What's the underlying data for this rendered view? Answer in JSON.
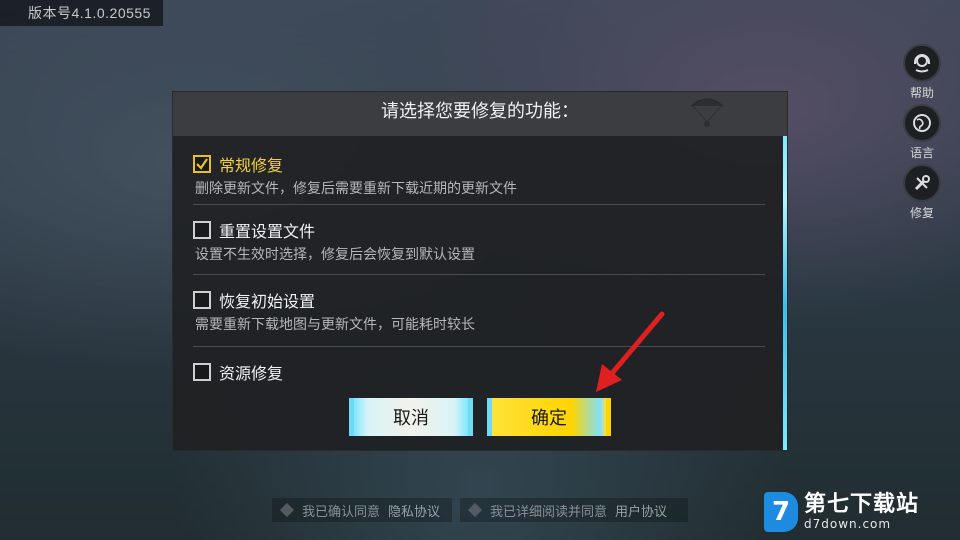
{
  "version": "版本号4.1.0.20555",
  "side_buttons": [
    {
      "label": "帮助",
      "icon": "headset-icon"
    },
    {
      "label": "语言",
      "icon": "globe-icon"
    },
    {
      "label": "修复",
      "icon": "wrench-icon"
    }
  ],
  "dialog": {
    "title": "请选择您要修复的功能：",
    "options": [
      {
        "title": "常规修复",
        "desc": "删除更新文件，修复后需要重新下载近期的更新文件",
        "checked": true
      },
      {
        "title": "重置设置文件",
        "desc": "设置不生效时选择，修复后会恢复到默认设置",
        "checked": false
      },
      {
        "title": "恢复初始设置",
        "desc": "需要重新下载地图与更新文件，可能耗时较长",
        "checked": false
      },
      {
        "title": "资源修复",
        "desc": "",
        "checked": false
      }
    ],
    "cancel_label": "取消",
    "confirm_label": "确定"
  },
  "bottom": {
    "privacy_prefix": "我已确认同意",
    "privacy_link": "隐私协议",
    "user_prefix": "我已详细阅读并同意",
    "user_link": "用户协议"
  },
  "watermark": {
    "logo_char": "7",
    "name": "第七下载站",
    "url": "d7down.com"
  },
  "colors": {
    "accent_yellow": "#f2d13a",
    "confirm_bg": "#ffd400",
    "cancel_bg": "#e8f6f2",
    "arrow_red": "#e02020"
  }
}
